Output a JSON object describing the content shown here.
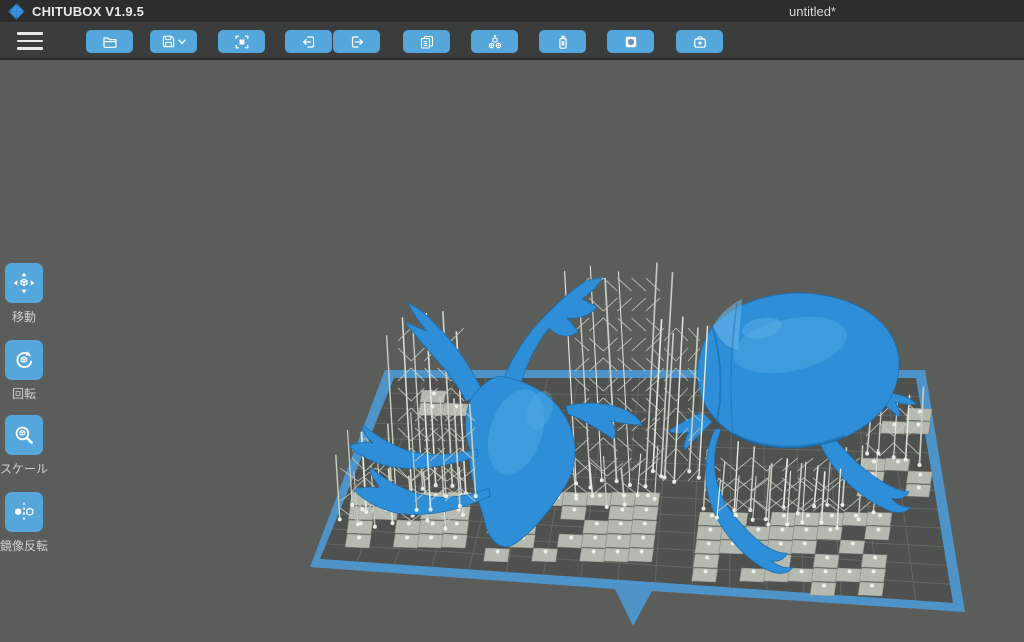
{
  "window": {
    "app_title": "CHITUBOX V1.9.5",
    "document_title": "untitled*"
  },
  "toolbar": {
    "menu_icon": "hamburger-icon",
    "buttons": [
      {
        "name": "open-file",
        "icon": "folder-open-icon"
      },
      {
        "name": "save",
        "icon": "save-icon",
        "dropdown_icon": "chevron-down-icon"
      },
      {
        "name": "screenshot",
        "icon": "screenshot-icon"
      },
      {
        "name": "previous",
        "icon": "arrow-left-box-icon"
      },
      {
        "name": "next",
        "icon": "arrow-right-box-icon"
      },
      {
        "name": "clone",
        "icon": "copy-icon"
      },
      {
        "name": "auto-layout",
        "icon": "arrange-icon"
      },
      {
        "name": "resin",
        "icon": "resin-bottle-icon"
      },
      {
        "name": "hollow",
        "icon": "hollow-icon"
      },
      {
        "name": "repair",
        "icon": "repair-icon"
      }
    ]
  },
  "sidebar": {
    "tools": [
      {
        "id": "move",
        "icon": "move-icon",
        "label": "移動"
      },
      {
        "id": "rotate",
        "icon": "rotate-icon",
        "label": "回転"
      },
      {
        "id": "scale",
        "icon": "scale-icon",
        "label": "スケール"
      },
      {
        "id": "mirror",
        "icon": "mirror-icon",
        "label": "鏡像反転"
      }
    ]
  },
  "viewport": {
    "models": [
      {
        "name": "stag-beetle-model"
      },
      {
        "name": "beetle-model"
      }
    ]
  },
  "colors": {
    "accent": "#55a6db",
    "titlebar_bg": "#2b2e2c",
    "toolbar_bg": "#3a3d3b",
    "toolbar_divider": "#272a28",
    "viewport_bg": "#5b5d5b",
    "plate_border": "#4e94c9",
    "plate_surface": "#4f514f",
    "plate_grid": "#6b6d69",
    "model_blue": "#2e8fd8",
    "model_shade": "#1e6fae",
    "model_highlight": "#58b0e6",
    "support_gray": "#c6ccc0",
    "support_light": "#e2e6dc",
    "pad_gray": "#b4bab0",
    "pad_edge": "#878d83",
    "ball_white": "#eef1e9",
    "label_text": "#cfcfcf",
    "title_text": "#e8e8e8"
  }
}
